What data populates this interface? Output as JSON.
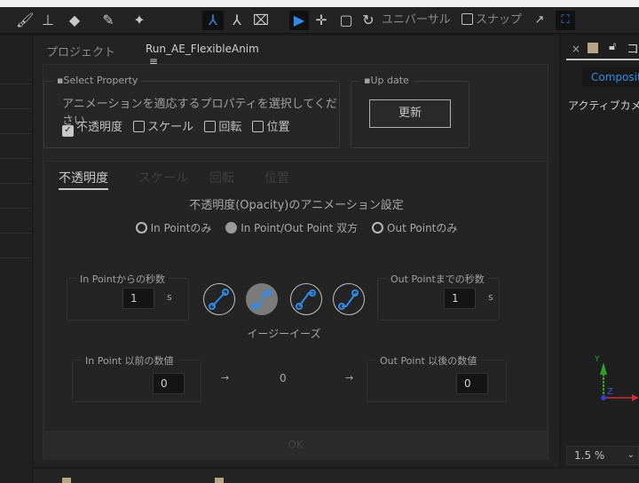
{
  "toolbar": {
    "tools": [
      "brush-tool",
      "clone-stamp-tool",
      "eraser-tool",
      "roto-brush-tool",
      "puppet-pin-tool",
      "local-axis-mode",
      "world-axis-mode",
      "view-axis-mode",
      "selection-tool",
      "move-tool",
      "rect-tool",
      "rotate-tool"
    ],
    "universal_label": "ユニバーサル",
    "snap_label": "スナップ"
  },
  "panel": {
    "tabs": [
      {
        "label": "プロジェクト"
      },
      {
        "label": "Run_AE_FlexibleAnim"
      }
    ],
    "menu_icon": "≡"
  },
  "select_property": {
    "title": "▪Select Property",
    "instruction": "アニメーションを適応するプロパティを選択してください",
    "checkboxes": [
      {
        "label": "不透明度",
        "checked": true
      },
      {
        "label": "スケール",
        "checked": false
      },
      {
        "label": "回転",
        "checked": false
      },
      {
        "label": "位置",
        "checked": false
      }
    ]
  },
  "update": {
    "title": "▪Up date",
    "button": "更新"
  },
  "prop_tabs": [
    {
      "label": "不透明度",
      "active": true
    },
    {
      "label": "スケール"
    },
    {
      "label": "回転"
    },
    {
      "label": "位置"
    }
  ],
  "settings": {
    "heading": "不透明度(Opacity)のアニメーション設定",
    "radios": [
      {
        "label": "In Pointのみ",
        "selected": false
      },
      {
        "label": "In Point/Out Point 双方",
        "selected": true
      },
      {
        "label": "Out Pointのみ",
        "selected": false
      }
    ],
    "in_seconds": {
      "title": "In Pointからの秒数",
      "value": "1",
      "unit": "s"
    },
    "out_seconds": {
      "title": "Out Pointまでの秒数",
      "value": "1",
      "unit": "s"
    },
    "ease_label": "イージーイーズ",
    "ease_buttons": [
      "linear",
      "easy-ease",
      "ease-in",
      "ease-out"
    ],
    "in_value": {
      "title": "In Point 以前の数値",
      "value": "0"
    },
    "arrow": "→",
    "middle_value": "0",
    "out_value": {
      "title": "Out Point 以後の数値",
      "value": "0"
    },
    "ok": "OK"
  },
  "right_panel": {
    "close": "×",
    "title_partial": "コ",
    "tab": "Compositio",
    "camera": "アクティブカメラ",
    "axis_y": "Y",
    "axis_z": "Z",
    "zoom": "1.5 %"
  },
  "colors": {
    "accent": "#2d8ceb",
    "label_swatch": "#b5a584"
  }
}
